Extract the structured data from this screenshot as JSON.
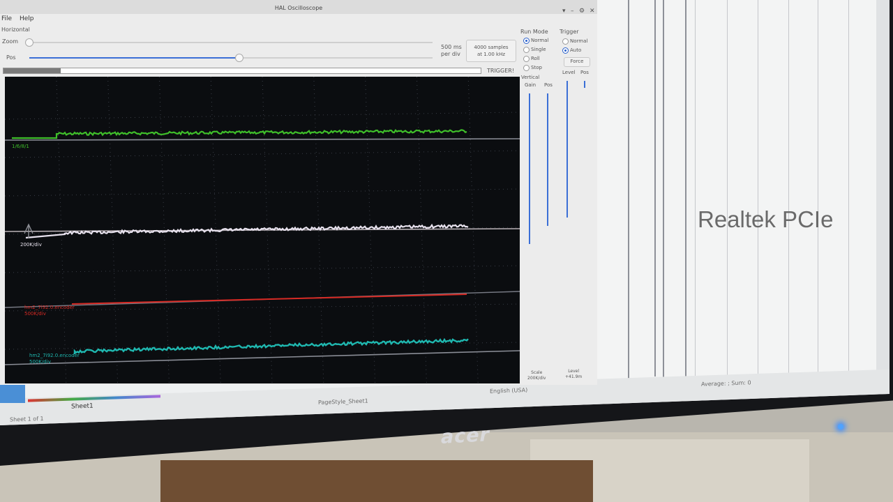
{
  "window": {
    "title": "HAL Oscilloscope",
    "menu": [
      "File",
      "Help"
    ]
  },
  "horizontal": {
    "section_label": "Horizontal",
    "zoom_label": "Zoom",
    "pos_label": "Pos",
    "timebase": "500 ms per div",
    "timebase_line1": "500 ms",
    "timebase_line2": "per div",
    "samples_line1": "4000 samples",
    "samples_line2": "at 1.00 kHz",
    "zoom_value": 0.0,
    "pos_value": 0.52,
    "progress_value": 0.12,
    "trigger_label": "TRIGGER!"
  },
  "run_mode": {
    "label": "Run Mode",
    "options": [
      "Normal",
      "Single",
      "Roll",
      "Stop"
    ],
    "selected": "Normal"
  },
  "trigger": {
    "label": "Trigger",
    "options": [
      "Normal",
      "Auto"
    ],
    "selected": "Auto",
    "force_label": "Force",
    "level_label": "Level",
    "pos_label": "Pos"
  },
  "vertical": {
    "label": "Vertical",
    "gain_label": "Gain",
    "pos_label": "Pos",
    "scale_label": "Scale",
    "scale_value": "200K/div",
    "level_label": "Level",
    "level_value": "+41.9m"
  },
  "channels": {
    "ch1_label": "1/6/8/1",
    "ch2_scale": "200K/div",
    "ch3_label": "hm2_7i92.0.encoder",
    "ch3_scale": "500K/div",
    "ch4_label": "hm2_7i92.0.encoder",
    "ch4_scale": "500K/div",
    "colors": {
      "ch1": "#3fbf2a",
      "ch2": "#e8e2ee",
      "ch3": "#d82a24",
      "ch4": "#1fb8b0"
    }
  },
  "background_sheet": {
    "cell_text": "Realtek PCIe",
    "sheet_tab": "Sheet1",
    "page_style": "PageStyle_Sheet1",
    "language": "English (USA)",
    "sheet_position": "Sheet 1 of 1",
    "stats": "Average: ; Sum: 0"
  },
  "monitor": {
    "brand": "acer"
  }
}
